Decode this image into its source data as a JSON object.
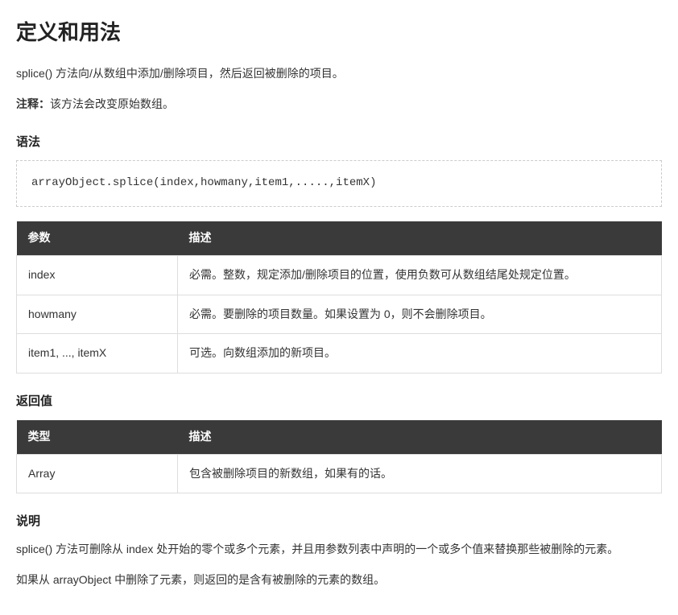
{
  "heading": "定义和用法",
  "intro": "splice() 方法向/从数组中添加/删除项目，然后返回被删除的项目。",
  "note_label": "注释：",
  "note_text": "该方法会改变原始数组。",
  "syntax_heading": "语法",
  "syntax_code": "arrayObject.splice(index,howmany,item1,.....,itemX)",
  "params_table": {
    "headers": [
      "参数",
      "描述"
    ],
    "rows": [
      {
        "name": "index",
        "desc": "必需。整数，规定添加/删除项目的位置，使用负数可从数组结尾处规定位置。"
      },
      {
        "name": "howmany",
        "desc": "必需。要删除的项目数量。如果设置为 0，则不会删除项目。"
      },
      {
        "name": "item1, ..., itemX",
        "desc": "可选。向数组添加的新项目。"
      }
    ]
  },
  "return_heading": "返回值",
  "return_table": {
    "headers": [
      "类型",
      "描述"
    ],
    "rows": [
      {
        "name": "Array",
        "desc": "包含被删除项目的新数组，如果有的话。"
      }
    ]
  },
  "explain_heading": "说明",
  "explain_p1": "splice() 方法可删除从 index 处开始的零个或多个元素，并且用参数列表中声明的一个或多个值来替换那些被删除的元素。",
  "explain_p2": "如果从 arrayObject 中删除了元素，则返回的是含有被删除的元素的数组。"
}
